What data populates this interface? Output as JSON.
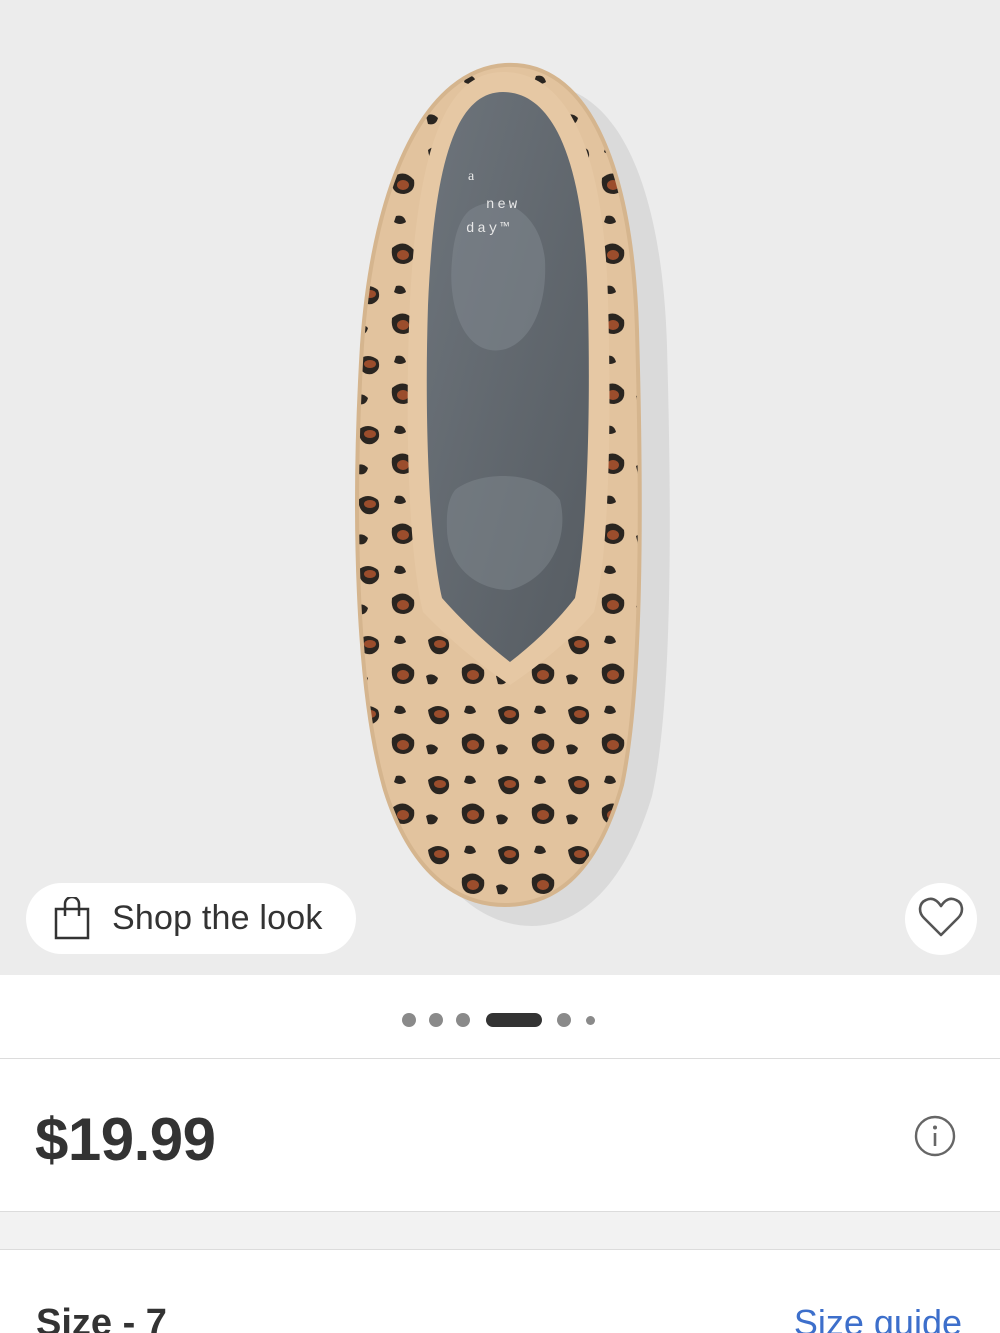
{
  "product_image": {
    "alt": "leopard print knit pointed flat",
    "insole_brand_lines": [
      "a",
      "new",
      "day™"
    ]
  },
  "shop_the_look": {
    "label": "Shop the look",
    "icon": "shopping-bag-icon"
  },
  "favorite": {
    "icon": "heart-outline-icon"
  },
  "carousel": {
    "total": 6,
    "active_index": 3
  },
  "price": {
    "value": "$19.99",
    "info_icon": "info-circle-icon"
  },
  "size": {
    "label": "Size - 7",
    "guide_link": "Size guide"
  },
  "colors": {
    "text_primary": "#333333",
    "link": "#3d6fcb",
    "hero_bg": "#ececec",
    "divider": "#dcdcdc"
  }
}
